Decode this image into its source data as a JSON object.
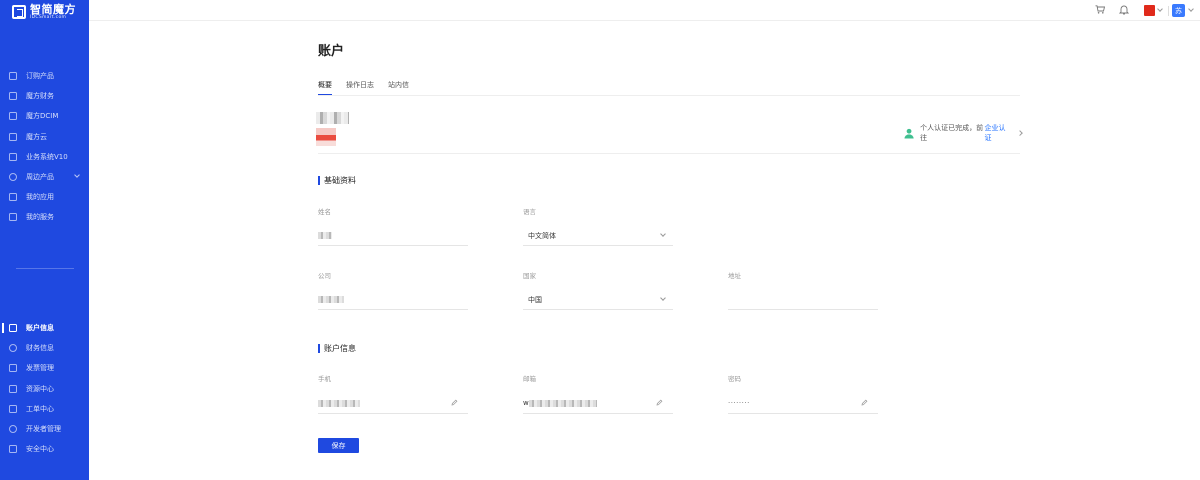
{
  "brand": {
    "title": "智简魔方",
    "subtitle": "IDCSmart.com"
  },
  "sidebar": {
    "top_items": [
      {
        "label": "订购产品",
        "icon": "cart-icon"
      },
      {
        "label": "魔方财务",
        "icon": "document-icon"
      },
      {
        "label": "魔方DCIM",
        "icon": "document-icon"
      },
      {
        "label": "魔方云",
        "icon": "document-icon"
      },
      {
        "label": "业务系统V10",
        "icon": "document-icon"
      },
      {
        "label": "周边产品",
        "icon": "gear-icon"
      },
      {
        "label": "我的应用",
        "icon": "document-icon"
      },
      {
        "label": "我的服务",
        "icon": "document-icon"
      }
    ],
    "bottom_items": [
      {
        "label": "账户信息",
        "icon": "user-card-icon",
        "active": true
      },
      {
        "label": "财务信息",
        "icon": "money-icon"
      },
      {
        "label": "发票管理",
        "icon": "invoice-icon"
      },
      {
        "label": "资源中心",
        "icon": "folder-icon"
      },
      {
        "label": "工单中心",
        "icon": "ticket-icon"
      },
      {
        "label": "开发者管理",
        "icon": "developer-icon"
      },
      {
        "label": "安全中心",
        "icon": "lock-icon"
      }
    ]
  },
  "topbar": {
    "avatar_text": "苏",
    "flag_color": "#e02a1b"
  },
  "page": {
    "title": "账户",
    "tabs": [
      "概要",
      "操作日志",
      "站内信"
    ],
    "active_tab": 0,
    "verify_text": "个人认证已完成，前往",
    "verify_link": "企业认证",
    "save_label": "保存"
  },
  "sections": {
    "basic_title": "基础资料",
    "account_title": "账户信息"
  },
  "fields": {
    "name_label": "姓名",
    "language_label": "语言",
    "language_value": "中文简体",
    "company_label": "公司",
    "country_label": "国家",
    "country_value": "中国",
    "address_label": "地址",
    "phone_label": "手机",
    "email_label": "邮箱",
    "email_prefix": "w",
    "password_label": "密码",
    "password_value": "········"
  },
  "colors": {
    "primary": "#1f49e0",
    "link": "#1f6fff",
    "verified": "#3fbf8f"
  }
}
